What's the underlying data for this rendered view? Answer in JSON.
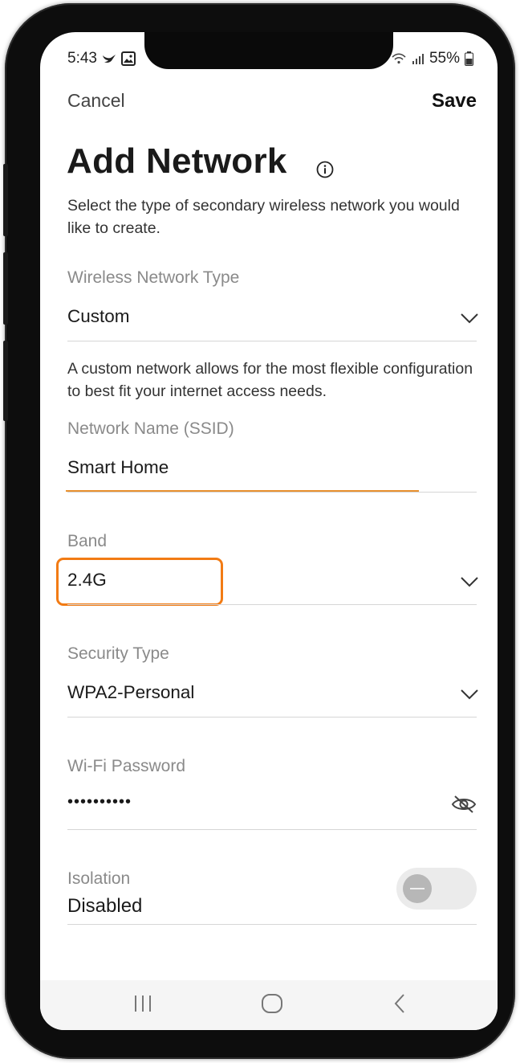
{
  "status_bar": {
    "time": "5:43",
    "battery": "55%"
  },
  "header": {
    "cancel_label": "Cancel",
    "save_label": "Save"
  },
  "page": {
    "title": "Add Network",
    "description": "Select the type of secondary wireless network you would like to create."
  },
  "fields": {
    "network_type": {
      "label": "Wireless Network Type",
      "value": "Custom",
      "help": "A custom network allows for the most flexible configuration to best fit your internet access needs."
    },
    "ssid": {
      "label": "Network Name (SSID)",
      "value": "Smart Home"
    },
    "band": {
      "label": "Band",
      "value": "2.4G"
    },
    "security": {
      "label": "Security Type",
      "value": "WPA2-Personal"
    },
    "password": {
      "label": "Wi-Fi Password",
      "value": "••••••••••"
    },
    "isolation": {
      "label": "Isolation",
      "value": "Disabled",
      "enabled": false
    }
  },
  "colors": {
    "accent": "#e8902e",
    "highlight": "#f27b14"
  }
}
